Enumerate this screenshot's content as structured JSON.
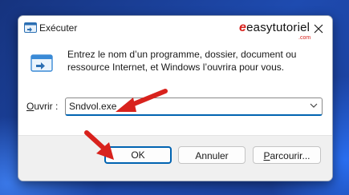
{
  "window": {
    "title": "Exécuter",
    "watermark_main": "easytutoriel",
    "watermark_sub": ".com"
  },
  "description": "Entrez le nom d’un programme, dossier, document ou ressource Internet, et Windows l’ouvrira pour vous.",
  "open_field": {
    "label_access_key": "O",
    "label_rest": "uvrir :",
    "value": "Sndvol.exe"
  },
  "buttons": {
    "ok": "OK",
    "cancel": "Annuler",
    "browse_access_key": "P",
    "browse_rest": "arcourir..."
  },
  "colors": {
    "accent": "#0063b1",
    "annotation_arrow": "#d8221d",
    "wallpaper": "#1d3c8f"
  },
  "icons": [
    "run-app-icon",
    "close-icon",
    "run-program-icon",
    "chevron-down-icon",
    "annotation-arrow-icon"
  ]
}
